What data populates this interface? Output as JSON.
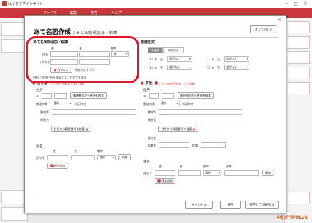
{
  "app": {
    "title": "はがきデザインキット",
    "menu": [
      "ファイル",
      "編集",
      "宛名",
      "ヘルプ"
    ],
    "bottom_text": "4枚さでPOLUS",
    "controls": {
      "minimize": "–",
      "maximize": "□",
      "close": "×"
    }
  },
  "dialog": {
    "title": "あて名面作成",
    "breadcrumb": "/ あて名新規追加・編集",
    "option_label": "オプション",
    "close_glyph": "×",
    "left": {
      "section_title": "あて名新規追加／編集",
      "col_sei": "姓",
      "col_mei": "名",
      "col_keisho": "敬称",
      "name_label": "氏名",
      "furigana_label": "ふりがな",
      "keisho_value": "様",
      "category_label": "カテゴリ",
      "category_value": "現在のカテゴリ",
      "note_text": "住所と会社住所を登録することができます",
      "home_label": "自宅",
      "home_link": "こちらの住所をあて名に印刷",
      "address_label": "住所",
      "postal_search_btn": "郵便番号から住所を検索",
      "pref_label": "都道府県",
      "pref_value": "選択",
      "city_label": "市区町村",
      "banchi_label": "番地等",
      "building_label": "建物名",
      "addr_to_postal_btn": "住所から郵便番号を検索",
      "joint_label": "連名",
      "joint_sei": "姓",
      "joint_mei": "名",
      "joint_keisho": "敬称",
      "joint_row_label": "連名 1",
      "joint_select": "選択",
      "delete_btn": "削除",
      "add_joint_btn": "連名追加"
    },
    "right": {
      "history_title": "履歴設定",
      "tab_send": "年賀状",
      "tab_mourning": "喪中欠礼",
      "year_rows": [
        {
          "year": "'14 年",
          "label": "送",
          "value": "選択なし"
        },
        {
          "year": "'14 年",
          "label": "受",
          "value": "選択なし"
        }
      ],
      "year_rows_right": [
        {
          "year": "'13 年",
          "label": "送",
          "value": "選択なし"
        },
        {
          "year": "'13 年",
          "label": "受",
          "value": "選択なし"
        }
      ],
      "company_label": "会社",
      "company_link": "こちらの住所をあて名に印刷",
      "address_label": "住所",
      "postal_search_btn": "郵便番号から住所を検索",
      "pref_label": "都道府県",
      "pref_value": "選択",
      "city_label": "市区町村",
      "banchi_label": "番地等",
      "building_label": "建物名",
      "addr_to_postal_btn": "住所から郵便番号を検索",
      "company_name_label": "会社名",
      "dept_label": "部署名",
      "title_label": "役職",
      "joint_label": "連名",
      "joint_sei": "姓",
      "joint_mei": "名",
      "joint_keisho": "敬称",
      "joint_title": "役職",
      "joint_row_label": "連名 1",
      "joint_select": "選択",
      "delete_btn": "削除",
      "add_joint_btn": "連名追加"
    },
    "footer": {
      "cancel": "キャンセル",
      "save": "保存",
      "save_new": "保存して新規追加"
    }
  }
}
